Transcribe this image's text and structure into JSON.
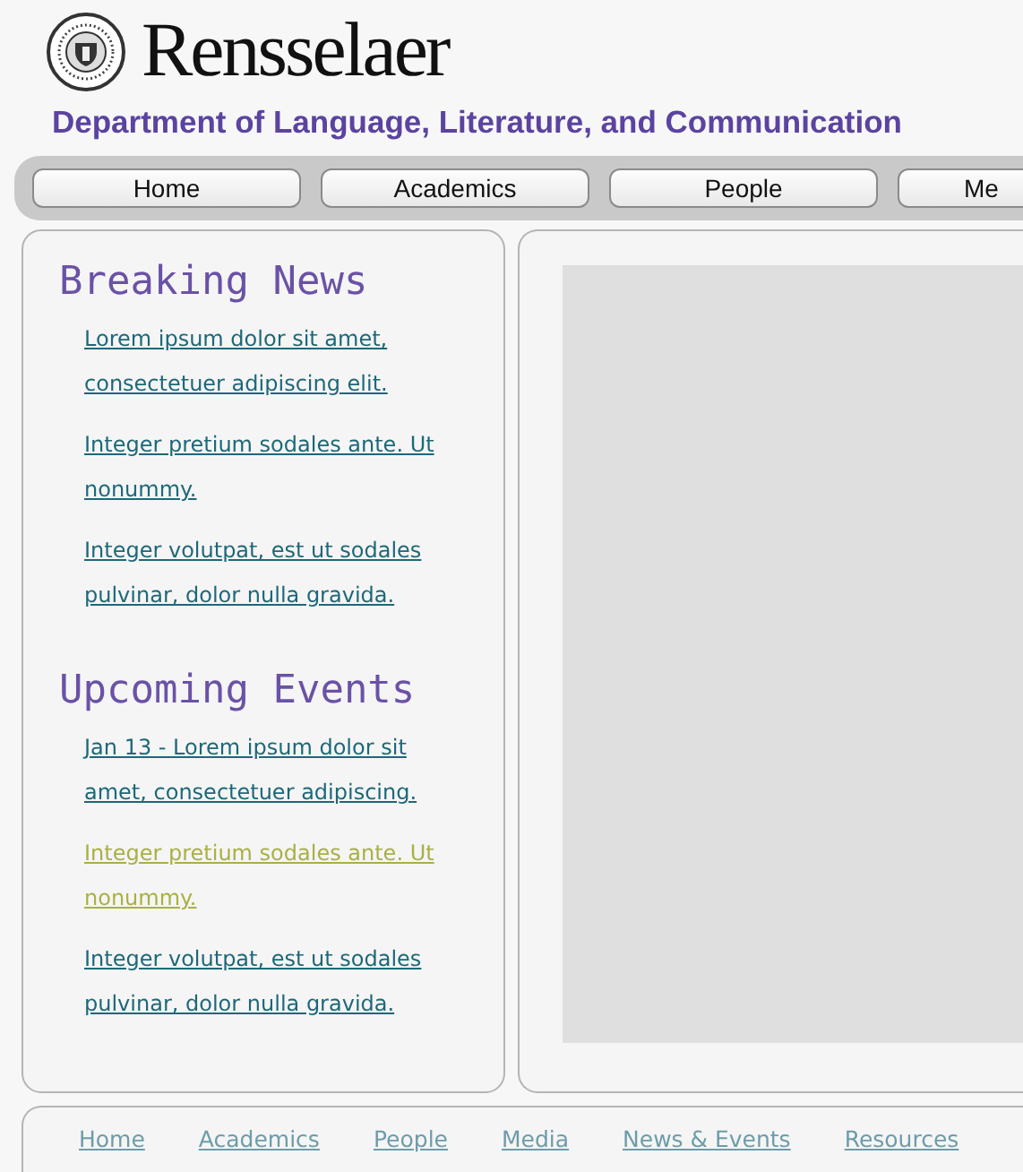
{
  "header": {
    "wordmark": "Rensselaer",
    "department": "Department of Language, Literature, and Communication"
  },
  "nav": [
    {
      "label": "Home"
    },
    {
      "label": "Academics"
    },
    {
      "label": "People"
    },
    {
      "label": "Me"
    }
  ],
  "sections": [
    {
      "title": "Breaking News",
      "items": [
        {
          "text": "Lorem ipsum dolor sit amet, consectetuer adipiscing elit.",
          "color": "#1d6878"
        },
        {
          "text": "Integer pretium sodales ante. Ut nonummy.",
          "color": "#1d6878"
        },
        {
          "text": "Integer volutpat, est ut sodales pulvinar, dolor nulla gravida.",
          "color": "#1d6878"
        }
      ]
    },
    {
      "title": "Upcoming Events",
      "items": [
        {
          "text": "Jan 13 - Lorem ipsum dolor sit amet,  consectetuer adipiscing.",
          "color": "#1d6878"
        },
        {
          "text": "Integer pretium sodales ante. Ut nonummy.",
          "color": "#a9b043"
        },
        {
          "text": "Integer volutpat, est ut sodales pulvinar, dolor nulla gravida.",
          "color": "#1d6878"
        }
      ]
    }
  ],
  "footer": [
    "Home",
    "Academics",
    "People",
    "Media",
    "News & Events",
    "Resources"
  ]
}
